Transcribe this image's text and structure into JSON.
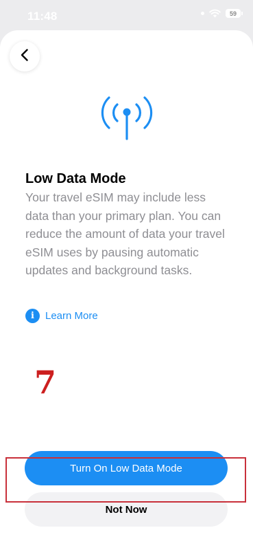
{
  "status_bar": {
    "time": "11:48",
    "battery": "59",
    "icons": [
      "dot-icon",
      "wifi-icon",
      "battery-icon"
    ]
  },
  "header": {
    "back_icon": "chevron-left-icon"
  },
  "hero_icon": "antenna-signal-icon",
  "content": {
    "title": "Low Data Mode",
    "description": "Your travel eSIM may include less data than your primary plan. You can reduce the amount of data your travel eSIM uses by pausing automatic updates and background tasks.",
    "learn_more": "Learn More",
    "learn_more_icon": "info-icon"
  },
  "annotation": {
    "number": "7",
    "color": "#cc1f1f",
    "highlight_color": "#c8303a"
  },
  "actions": {
    "primary_label": "Turn On Low Data Mode",
    "secondary_label": "Not Now"
  },
  "colors": {
    "accent": "#1c8ef3",
    "secondary_text": "#8e8e93",
    "background": "#ececee"
  }
}
